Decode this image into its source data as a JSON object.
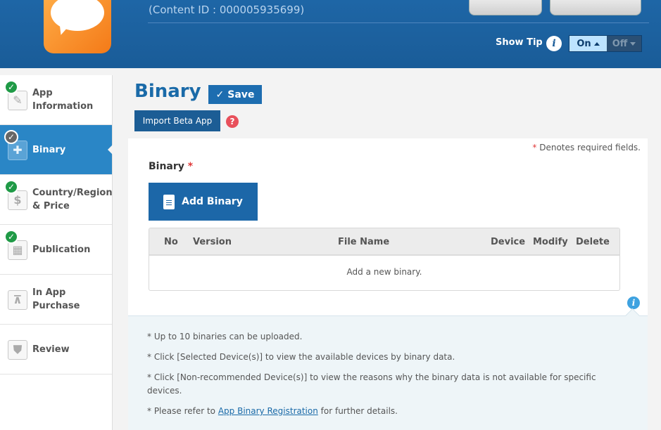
{
  "header": {
    "content_id": "(Content ID : 000005935699)",
    "show_tip_label": "Show Tip",
    "info_glyph": "i",
    "toggle_on": "On",
    "toggle_off": "Off"
  },
  "sidebar": {
    "items": [
      {
        "label": "App Information",
        "icon": "pencil-icon",
        "status": "complete",
        "active": false
      },
      {
        "label": "Binary",
        "icon": "puzzle-icon",
        "status": "in-progress",
        "active": true
      },
      {
        "label": "Country/Region & Price",
        "icon": "dollar-icon",
        "status": "complete",
        "active": false
      },
      {
        "label": "Publication",
        "icon": "calendar-icon",
        "status": "complete",
        "active": false
      },
      {
        "label": "In App Purchase",
        "icon": "hierarchy-icon",
        "status": "none",
        "active": false
      },
      {
        "label": "Review",
        "icon": "shield-icon",
        "status": "none",
        "active": false
      }
    ]
  },
  "main": {
    "title": "Binary",
    "save_label": "Save",
    "import_label": "Import Beta App",
    "help_glyph": "?",
    "required_note": "Denotes required fields.",
    "required_star": "*",
    "section_label": "Binary",
    "add_binary_label": "Add Binary",
    "table": {
      "columns": [
        "No",
        "Version",
        "File Name",
        "Device",
        "Modify",
        "Delete"
      ],
      "empty_text": "Add a new binary."
    },
    "tips": [
      "* Up to 10 binaries can be uploaded.",
      "* Click [Selected Device(s)] to view the available devices by binary data.",
      "* Click [Non-recommended Device(s)] to view the reasons why the binary data is not available for specific devices."
    ],
    "tip_link_prefix": "* Please refer to ",
    "tip_link_text": "App Binary Registration",
    "tip_link_suffix": " for further details."
  },
  "colors": {
    "header_bg": "#1a5c98",
    "accent": "#1c67a8",
    "active_sidebar": "#2a86c6",
    "check_green": "#1f9a46",
    "required_red": "#e03a3a"
  }
}
